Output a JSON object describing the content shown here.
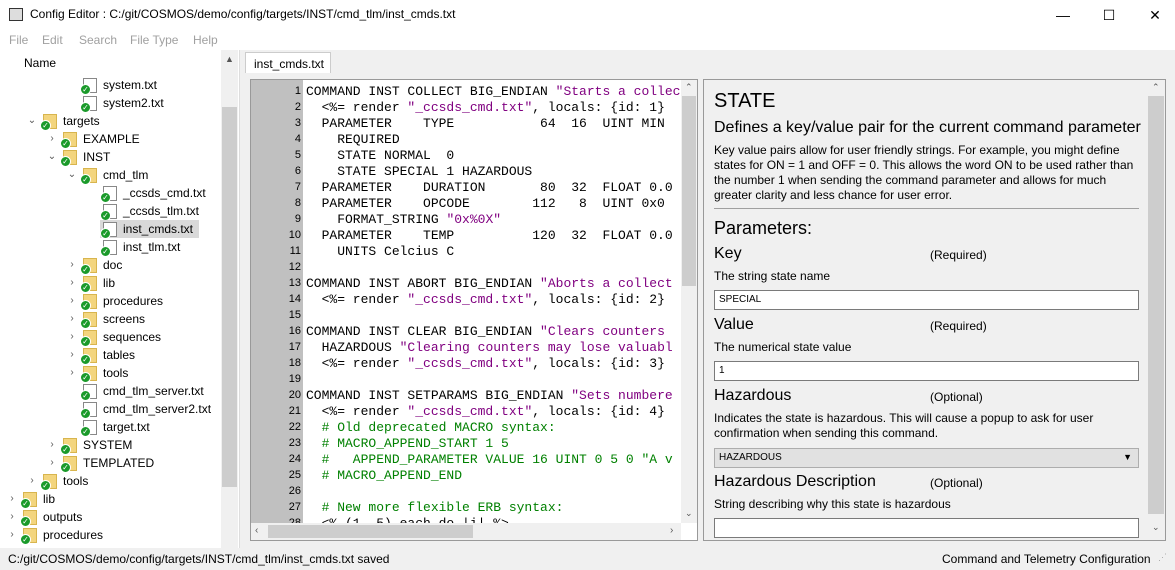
{
  "window": {
    "title": "Config Editor : C:/git/COSMOS/demo/config/targets/INST/cmd_tlm/inst_cmds.txt",
    "minimize": "—",
    "maximize": "☐",
    "close": "✕"
  },
  "menu": [
    "File",
    "Edit",
    "Search",
    "File Type",
    "Help"
  ],
  "tree": {
    "header": "Name",
    "items": [
      {
        "label": "system.txt",
        "level": 3,
        "type": "file",
        "expand": ""
      },
      {
        "label": "system2.txt",
        "level": 3,
        "type": "file",
        "expand": ""
      },
      {
        "label": "targets",
        "level": 1,
        "type": "folder",
        "expand": "open"
      },
      {
        "label": "EXAMPLE",
        "level": 2,
        "type": "folder",
        "expand": "closed"
      },
      {
        "label": "INST",
        "level": 2,
        "type": "folder",
        "expand": "open"
      },
      {
        "label": "cmd_tlm",
        "level": 3,
        "type": "folder",
        "expand": "open"
      },
      {
        "label": "_ccsds_cmd.txt",
        "level": 4,
        "type": "file",
        "expand": ""
      },
      {
        "label": "_ccsds_tlm.txt",
        "level": 4,
        "type": "file",
        "expand": ""
      },
      {
        "label": "inst_cmds.txt",
        "level": 4,
        "type": "file",
        "expand": "",
        "selected": true
      },
      {
        "label": "inst_tlm.txt",
        "level": 4,
        "type": "file",
        "expand": ""
      },
      {
        "label": "doc",
        "level": 3,
        "type": "folder",
        "expand": "closed"
      },
      {
        "label": "lib",
        "level": 3,
        "type": "folder",
        "expand": "closed"
      },
      {
        "label": "procedures",
        "level": 3,
        "type": "folder",
        "expand": "closed"
      },
      {
        "label": "screens",
        "level": 3,
        "type": "folder",
        "expand": "closed"
      },
      {
        "label": "sequences",
        "level": 3,
        "type": "folder",
        "expand": "closed"
      },
      {
        "label": "tables",
        "level": 3,
        "type": "folder",
        "expand": "closed"
      },
      {
        "label": "tools",
        "level": 3,
        "type": "folder",
        "expand": "closed"
      },
      {
        "label": "cmd_tlm_server.txt",
        "level": 3,
        "type": "file",
        "expand": ""
      },
      {
        "label": "cmd_tlm_server2.txt",
        "level": 3,
        "type": "file",
        "expand": ""
      },
      {
        "label": "target.txt",
        "level": 3,
        "type": "file",
        "expand": ""
      },
      {
        "label": "SYSTEM",
        "level": 2,
        "type": "folder",
        "expand": "closed"
      },
      {
        "label": "TEMPLATED",
        "level": 2,
        "type": "folder",
        "expand": "closed"
      },
      {
        "label": "tools",
        "level": 1,
        "type": "folder",
        "expand": "closed"
      },
      {
        "label": "lib",
        "level": 0,
        "type": "folder",
        "expand": "closed"
      },
      {
        "label": "outputs",
        "level": 0,
        "type": "folder",
        "expand": "closed"
      },
      {
        "label": "procedures",
        "level": 0,
        "type": "folder",
        "expand": "closed"
      }
    ]
  },
  "tab": "inst_cmds.txt",
  "editor": {
    "lines": [
      [
        [
          "COMMAND INST COLLECT BIG_ENDIAN ",
          ""
        ],
        [
          "\"Starts a collect",
          "s"
        ]
      ],
      [
        [
          "  <%= render ",
          ""
        ],
        [
          "\"_ccsds_cmd.txt\"",
          "s"
        ],
        [
          ", locals: {id: 1}",
          ""
        ]
      ],
      [
        [
          "  PARAMETER    TYPE           64  16  UINT MIN",
          ""
        ]
      ],
      [
        [
          "    REQUIRED",
          ""
        ]
      ],
      [
        [
          "    STATE NORMAL  0",
          ""
        ]
      ],
      [
        [
          "    STATE SPECIAL 1 HAZARDOUS",
          ""
        ]
      ],
      [
        [
          "  PARAMETER    DURATION       80  32  FLOAT 0.0",
          ""
        ]
      ],
      [
        [
          "  PARAMETER    OPCODE        112   8  UINT 0x0",
          ""
        ]
      ],
      [
        [
          "    FORMAT_STRING ",
          ""
        ],
        [
          "\"0x%0X\"",
          "s"
        ]
      ],
      [
        [
          "  PARAMETER    TEMP          120  32  FLOAT 0.0",
          ""
        ]
      ],
      [
        [
          "    UNITS Celcius C",
          ""
        ]
      ],
      [
        [
          "",
          ""
        ]
      ],
      [
        [
          "COMMAND INST ABORT BIG_ENDIAN ",
          ""
        ],
        [
          "\"Aborts a collect",
          "s"
        ]
      ],
      [
        [
          "  <%= render ",
          ""
        ],
        [
          "\"_ccsds_cmd.txt\"",
          "s"
        ],
        [
          ", locals: {id: 2}",
          ""
        ]
      ],
      [
        [
          "",
          ""
        ]
      ],
      [
        [
          "COMMAND INST CLEAR BIG_ENDIAN ",
          ""
        ],
        [
          "\"Clears counters",
          "s"
        ]
      ],
      [
        [
          "  HAZARDOUS ",
          ""
        ],
        [
          "\"Clearing counters may lose valuabl",
          "s"
        ]
      ],
      [
        [
          "  <%= render ",
          ""
        ],
        [
          "\"_ccsds_cmd.txt\"",
          "s"
        ],
        [
          ", locals: {id: 3}",
          ""
        ]
      ],
      [
        [
          "",
          ""
        ]
      ],
      [
        [
          "COMMAND INST SETPARAMS BIG_ENDIAN ",
          ""
        ],
        [
          "\"Sets numbere",
          "s"
        ]
      ],
      [
        [
          "  <%= render ",
          ""
        ],
        [
          "\"_ccsds_cmd.txt\"",
          "s"
        ],
        [
          ", locals: {id: 4}",
          ""
        ]
      ],
      [
        [
          "  # Old deprecated MACRO syntax:",
          "c"
        ]
      ],
      [
        [
          "  # MACRO_APPEND_START 1 5",
          "c"
        ]
      ],
      [
        [
          "  #   APPEND_PARAMETER VALUE 16 UINT 0 5 0 \"A v",
          "c"
        ]
      ],
      [
        [
          "  # MACRO_APPEND_END",
          "c"
        ]
      ],
      [
        [
          "",
          ""
        ]
      ],
      [
        [
          "  # New more flexible ERB syntax:",
          "c"
        ]
      ],
      [
        [
          "  <% (1..5).each do |i| %>",
          ""
        ]
      ]
    ]
  },
  "help": {
    "title": "STATE",
    "subtitle": "Defines a key/value pair for the current command parameter",
    "description": "Key value pairs allow for user friendly strings. For example, you might define states for ON = 1 and OFF = 0. This allows the word ON to be used rather than the number 1 when sending the command parameter and allows for much greater clarity and less chance for user error.",
    "params_heading": "Parameters:",
    "params": [
      {
        "name": "Key",
        "req": "(Required)",
        "desc": "The string state name",
        "value": "SPECIAL",
        "kind": "text"
      },
      {
        "name": "Value",
        "req": "(Required)",
        "desc": "The numerical state value",
        "value": "1",
        "kind": "text"
      },
      {
        "name": "Hazardous",
        "req": "(Optional)",
        "desc": "Indicates the state is hazardous. This will cause a popup to ask for user confirmation when sending this command.",
        "value": "HAZARDOUS",
        "kind": "select"
      },
      {
        "name": "Hazardous Description",
        "req": "(Optional)",
        "desc": "String describing why this state is hazardous",
        "value": "",
        "kind": "text"
      }
    ]
  },
  "status": {
    "left": "C:/git/COSMOS/demo/config/targets/INST/cmd_tlm/inst_cmds.txt saved",
    "right": "Command and Telemetry Configuration"
  }
}
